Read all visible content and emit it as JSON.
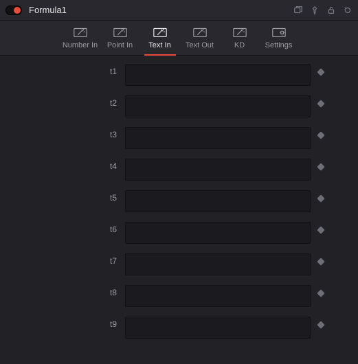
{
  "header": {
    "title": "Formula1"
  },
  "tabs": [
    {
      "id": "number-in",
      "label": "Number In",
      "icon": "wand"
    },
    {
      "id": "point-in",
      "label": "Point In",
      "icon": "wand"
    },
    {
      "id": "text-in",
      "label": "Text In",
      "icon": "wand",
      "active": true
    },
    {
      "id": "text-out",
      "label": "Text Out",
      "icon": "wand"
    },
    {
      "id": "kd",
      "label": "KD",
      "icon": "wand"
    },
    {
      "id": "settings",
      "label": "Settings",
      "icon": "gear"
    }
  ],
  "fields": [
    {
      "label": "t1",
      "value": ""
    },
    {
      "label": "t2",
      "value": ""
    },
    {
      "label": "t3",
      "value": ""
    },
    {
      "label": "t4",
      "value": ""
    },
    {
      "label": "t5",
      "value": ""
    },
    {
      "label": "t6",
      "value": ""
    },
    {
      "label": "t7",
      "value": ""
    },
    {
      "label": "t8",
      "value": ""
    },
    {
      "label": "t9",
      "value": ""
    }
  ]
}
